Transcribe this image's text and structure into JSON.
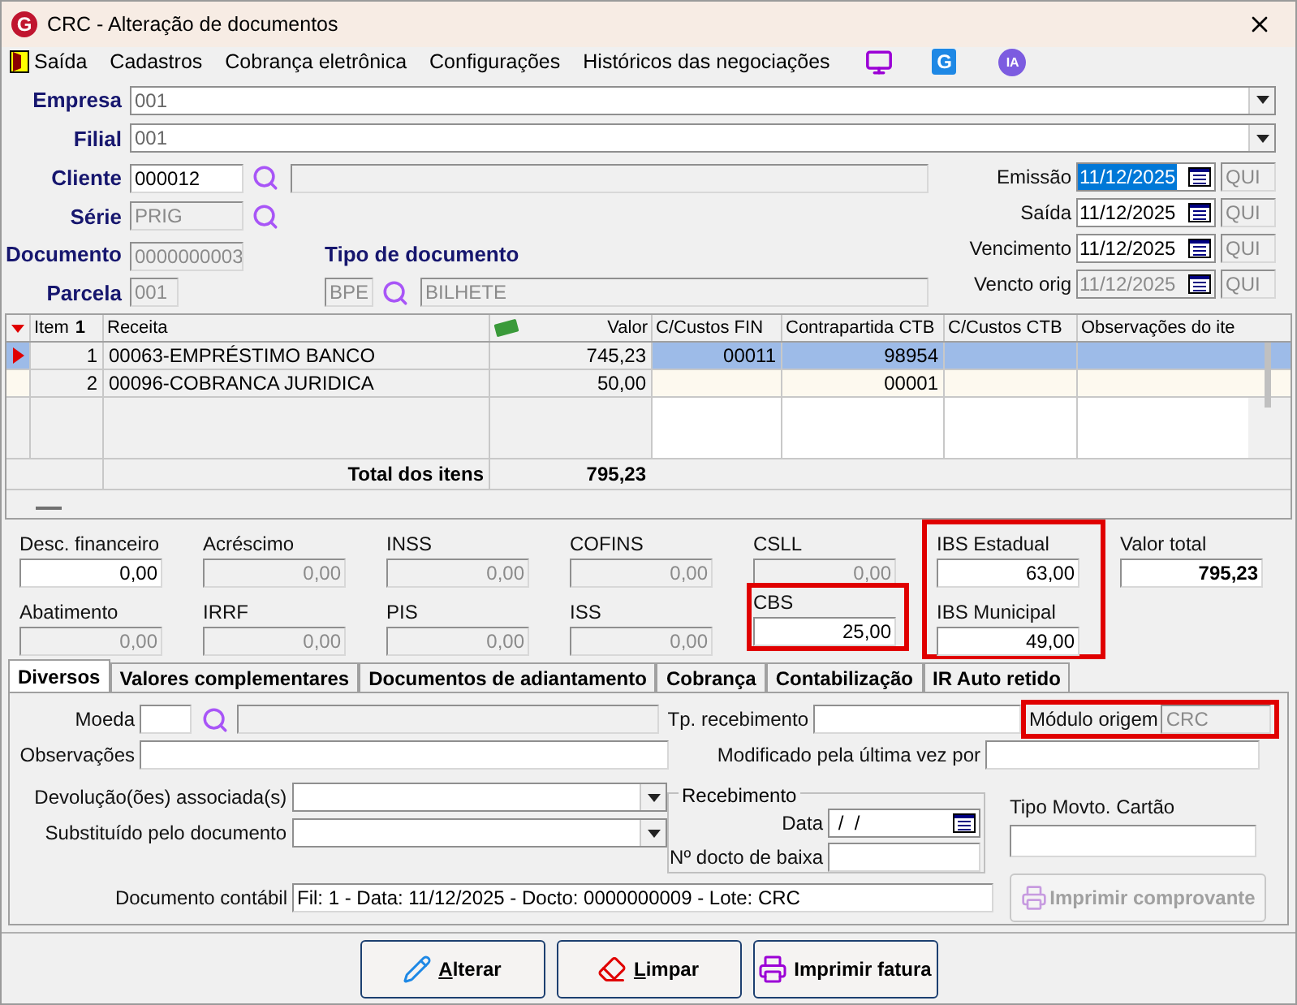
{
  "window": {
    "logo": "G",
    "title": "CRC - Alteração de documentos"
  },
  "menu": [
    {
      "kind": "exit",
      "label": "Saída"
    },
    {
      "kind": "text",
      "label": "Cadastros"
    },
    {
      "kind": "text",
      "label": "Cobrança eletrônica"
    },
    {
      "kind": "text",
      "label": "Configurações"
    },
    {
      "kind": "text",
      "label": "Históricos das negociações"
    },
    {
      "kind": "monitor"
    },
    {
      "kind": "logo",
      "label": "G"
    },
    {
      "kind": "badge",
      "label": "IA"
    }
  ],
  "header": {
    "empresa": {
      "label": "Empresa",
      "code": "001"
    },
    "filial": {
      "label": "Filial",
      "code": "001"
    },
    "cliente": {
      "label": "Cliente",
      "code": "000012",
      "disabled": false
    },
    "serie": {
      "label": "Série",
      "code": "PRIG",
      "disabled": true
    },
    "documento": {
      "label": "Documento",
      "code": "0000000003",
      "disabled": true
    },
    "parcela": {
      "label": "Parcela",
      "code": "001",
      "disabled": true
    },
    "tipo_documento": {
      "label": "Tipo de documento",
      "code": "BPE",
      "name": "BILHETE"
    },
    "dates": [
      {
        "label": "Emissão",
        "value": "11/12/2025",
        "weekday": "QUI",
        "selected": true,
        "disabled": false
      },
      {
        "label": "Saída",
        "value": "11/12/2025",
        "weekday": "QUI",
        "selected": false,
        "disabled": false
      },
      {
        "label": "Vencimento",
        "value": "11/12/2025",
        "weekday": "QUI",
        "selected": false,
        "disabled": false
      },
      {
        "label": "Vencto orig",
        "value": "11/12/2025",
        "weekday": "QUI",
        "selected": false,
        "disabled": true
      }
    ]
  },
  "grid": {
    "columns": [
      "Item",
      "Receita",
      "Valor",
      "C/Custos FIN",
      "Contrapartida CTB",
      "C/Custos CTB",
      "Observações do ite"
    ],
    "sort_mark": "1",
    "rows": [
      {
        "selected": true,
        "item": "1",
        "receita": "00063-EMPRÉSTIMO BANCO",
        "valor": "745,23",
        "cc_fin": "00011",
        "contrapartida": "98954"
      },
      {
        "selected": false,
        "item": "2",
        "receita": "00096-COBRANCA JURIDICA",
        "valor": "50,00",
        "contrapartida": "00001"
      }
    ],
    "total": {
      "label": "Total dos itens",
      "value": "795,23"
    }
  },
  "taxes": [
    {
      "highlighted": false,
      "fields": [
        {
          "label": "Desc. financeiro",
          "value": "0,00",
          "disabled": false,
          "highlighted": false
        },
        {
          "label": "Abatimento",
          "value": "0,00",
          "disabled": true,
          "highlighted": false
        }
      ]
    },
    {
      "highlighted": false,
      "fields": [
        {
          "label": "Acréscimo",
          "value": "0,00",
          "disabled": true,
          "highlighted": false
        },
        {
          "label": "IRRF",
          "value": "0,00",
          "disabled": true,
          "highlighted": false
        }
      ]
    },
    {
      "highlighted": false,
      "fields": [
        {
          "label": "INSS",
          "value": "0,00",
          "disabled": true,
          "highlighted": false
        },
        {
          "label": "PIS",
          "value": "0,00",
          "disabled": true,
          "highlighted": false
        }
      ]
    },
    {
      "highlighted": false,
      "fields": [
        {
          "label": "COFINS",
          "value": "0,00",
          "disabled": true,
          "highlighted": false
        },
        {
          "label": "ISS",
          "value": "0,00",
          "disabled": true,
          "highlighted": false
        }
      ]
    },
    {
      "highlighted": false,
      "fields": [
        {
          "label": "CSLL",
          "value": "0,00",
          "disabled": true,
          "highlighted": false
        },
        {
          "label": "CBS",
          "value": "25,00",
          "disabled": false,
          "highlighted": true
        }
      ]
    },
    {
      "highlighted": true,
      "fields": [
        {
          "label": "IBS Estadual",
          "value": "63,00",
          "disabled": false,
          "highlighted": false
        },
        {
          "label": "IBS Municipal",
          "value": "49,00",
          "disabled": false,
          "highlighted": false
        }
      ]
    },
    {
      "highlighted": false,
      "fields": [
        {
          "label": "Valor total",
          "value": "795,23",
          "disabled": false,
          "highlighted": false,
          "bold": true
        }
      ]
    }
  ],
  "tabs": [
    {
      "label": "Diversos",
      "selected": true
    },
    {
      "label": "Valores complementares",
      "selected": false
    },
    {
      "label": "Documentos de adiantamento",
      "selected": false
    },
    {
      "label": "Cobrança",
      "selected": false
    },
    {
      "label": "Contabilização",
      "selected": false
    },
    {
      "label": "IR Auto retido",
      "selected": false
    }
  ],
  "panel": {
    "moeda": {
      "label": "Moeda"
    },
    "tp_recebimento": {
      "label": "Tp. recebimento"
    },
    "modulo_origem": {
      "label": "Módulo origem",
      "value": "CRC",
      "highlighted": true
    },
    "observacoes": {
      "label": "Observações"
    },
    "modificado": {
      "label": "Modificado pela última vez por"
    },
    "devolucoes": {
      "label": "Devolução(ões) associada(s)"
    },
    "substituido": {
      "label": "Substituído pelo documento"
    },
    "recebimento": {
      "title": "Recebimento",
      "data_label": "Data",
      "data_value": " /  /",
      "docto_label": "Nº docto de baixa"
    },
    "tipo_movto": {
      "label": "Tipo Movto. Cartão"
    },
    "imprimir_comprovante": {
      "label": "Imprimir comprovante",
      "disabled": true
    },
    "documento_contabil": {
      "label": "Documento contábil",
      "value": "Fil: 1 - Data: 11/12/2025 - Docto: 0000000009 - Lote: CRC"
    }
  },
  "buttons": [
    {
      "kind": "edit",
      "label": "Alterar",
      "underlined": true
    },
    {
      "kind": "clear",
      "label": "Limpar",
      "underlined": true
    },
    {
      "kind": "print",
      "label": "Imprimir fatura",
      "underlined": false
    }
  ]
}
